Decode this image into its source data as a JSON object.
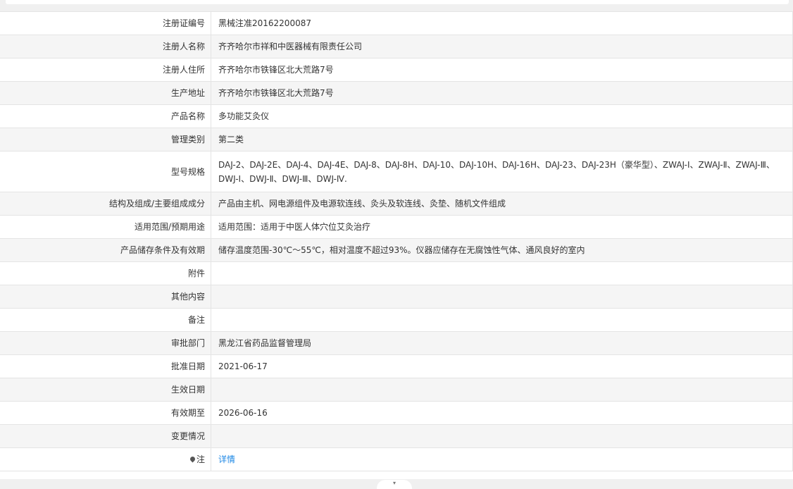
{
  "rows": [
    {
      "label": "注册证编号",
      "value": "黑械注准20162200087"
    },
    {
      "label": "注册人名称",
      "value": "齐齐哈尔市祥和中医器械有限责任公司"
    },
    {
      "label": "注册人住所",
      "value": "齐齐哈尔市铁锋区北大荒路7号"
    },
    {
      "label": "生产地址",
      "value": "齐齐哈尔市铁锋区北大荒路7号"
    },
    {
      "label": "产品名称",
      "value": "多功能艾灸仪"
    },
    {
      "label": "管理类别",
      "value": "第二类"
    },
    {
      "label": "型号规格",
      "value": "DAJ-2、DAJ-2E、DAJ-4、DAJ-4E、DAJ-8、DAJ-8H、DAJ-10、DAJ-10H、DAJ-16H、DAJ-23、DAJ-23H（豪华型）、ZWAJ-Ⅰ、ZWAJ-Ⅱ、ZWAJ-Ⅲ、DWJ-Ⅰ、DWJ-Ⅱ、DWJ-Ⅲ、DWJ-Ⅳ."
    },
    {
      "label": "结构及组成/主要组成成分",
      "value": "产品由主机、网电源组件及电源软连线、灸头及软连线、灸垫、随机文件组成"
    },
    {
      "label": "适用范围/预期用途",
      "value": "适用范围：适用于中医人体穴位艾灸治疗"
    },
    {
      "label": "产品储存条件及有效期",
      "value": "储存温度范围-30℃～55℃，相对温度不超过93%。仪器应储存在无腐蚀性气体、通风良好的室内"
    },
    {
      "label": "附件",
      "value": ""
    },
    {
      "label": "其他内容",
      "value": ""
    },
    {
      "label": "备注",
      "value": ""
    },
    {
      "label": "审批部门",
      "value": "黑龙江省药品监督管理局"
    },
    {
      "label": "批准日期",
      "value": "2021-06-17"
    },
    {
      "label": "生效日期",
      "value": ""
    },
    {
      "label": "有效期至",
      "value": "2026-06-16"
    },
    {
      "label": "变更情况",
      "value": ""
    },
    {
      "label": "注",
      "value": "详情",
      "icon": "pin-icon",
      "link": true
    }
  ],
  "collapse_toggle": {
    "icon": "chevron-down-icon",
    "glyph": "▾"
  }
}
